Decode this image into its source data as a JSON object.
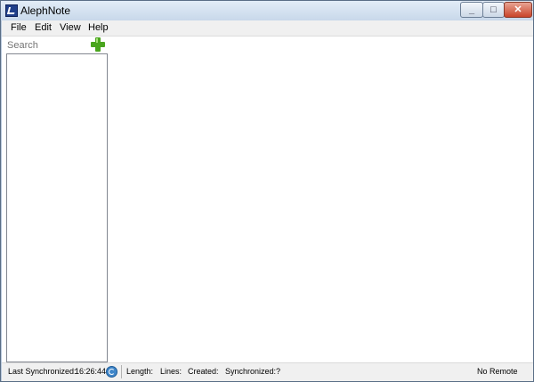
{
  "window": {
    "title": "AlephNote"
  },
  "menu": {
    "items": [
      "File",
      "Edit",
      "View",
      "Help"
    ]
  },
  "search": {
    "placeholder": "Search"
  },
  "status": {
    "last_sync_label": "Last Synchronized:",
    "last_sync_time": "16:26:44",
    "length_label": "Length:",
    "lines_label": "Lines:",
    "created_label": "Created:",
    "synchronized_label": "Synchronized:",
    "synchronized_value": "?",
    "remote_label": "No Remote"
  },
  "colors": {
    "accent_add": "#4aa51e",
    "sync": "#3f86c9",
    "close_button": "#c9442a"
  },
  "icons": {
    "app": "alephnote-app-icon",
    "add": "add-note-icon",
    "sync": "sync-icon"
  }
}
